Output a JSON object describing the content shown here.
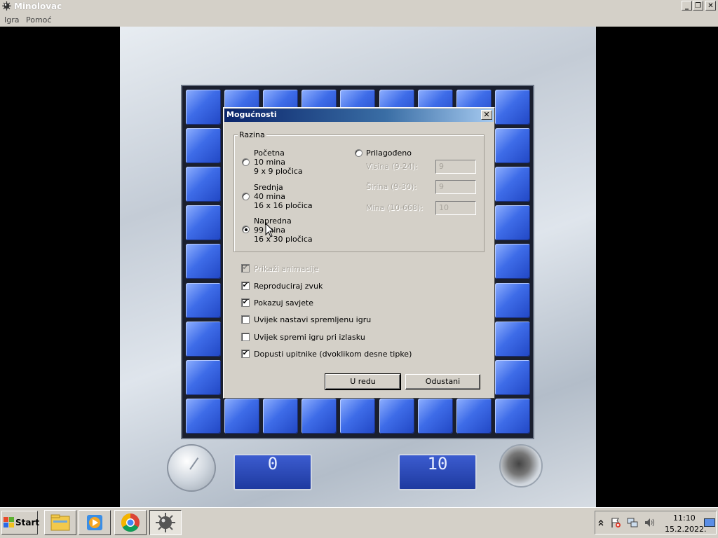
{
  "window": {
    "title": "Minolovac",
    "icon": "mine-icon",
    "controls": {
      "minimize": "_",
      "restore": "❐",
      "close": "✕"
    }
  },
  "menu": {
    "items": [
      "Igra",
      "Pomoć"
    ]
  },
  "game": {
    "timer": "0",
    "mines_left": "10"
  },
  "dialog": {
    "title": "Mogućnosti",
    "close": "✕",
    "level_group": "Razina",
    "levels": [
      {
        "line1": "Početna",
        "line2": "10 mina",
        "line3": "9 x 9 pločica",
        "selected": false
      },
      {
        "line1": "Srednja",
        "line2": "40 mina",
        "line3": "16 x 16 pločica",
        "selected": false
      },
      {
        "line1": "Napredna",
        "line2": "99 mina",
        "line3": "16 x 30 pločica",
        "selected": true
      }
    ],
    "custom": {
      "label": "Prilagođeno",
      "height_label": "Visina (9-24):",
      "height_value": "9",
      "width_label": "Širina (9-30):",
      "width_value": "9",
      "mines_label": "Mina (10-668):",
      "mines_value": "10"
    },
    "options": [
      {
        "label": "Prikaži animacije",
        "checked": true,
        "disabled": true
      },
      {
        "label": "Reproduciraj zvuk",
        "checked": true,
        "disabled": false
      },
      {
        "label": "Pokazuj savjete",
        "checked": true,
        "disabled": false
      },
      {
        "label": "Uvijek nastavi spremljenu igru",
        "checked": false,
        "disabled": false
      },
      {
        "label": "Uvijek spremi igru pri izlasku",
        "checked": false,
        "disabled": false
      },
      {
        "label": "Dopusti upitnike (dvoklikom desne tipke)",
        "checked": true,
        "disabled": false
      }
    ],
    "ok_label": "U redu",
    "cancel_label": "Odustani"
  },
  "taskbar": {
    "start_label": "Start",
    "apps": [
      "file-explorer-icon",
      "media-player-icon",
      "chrome-icon",
      "minesweeper-icon"
    ],
    "active_app": "minesweeper-icon",
    "time": "11:10",
    "date": "15.2.2022."
  }
}
